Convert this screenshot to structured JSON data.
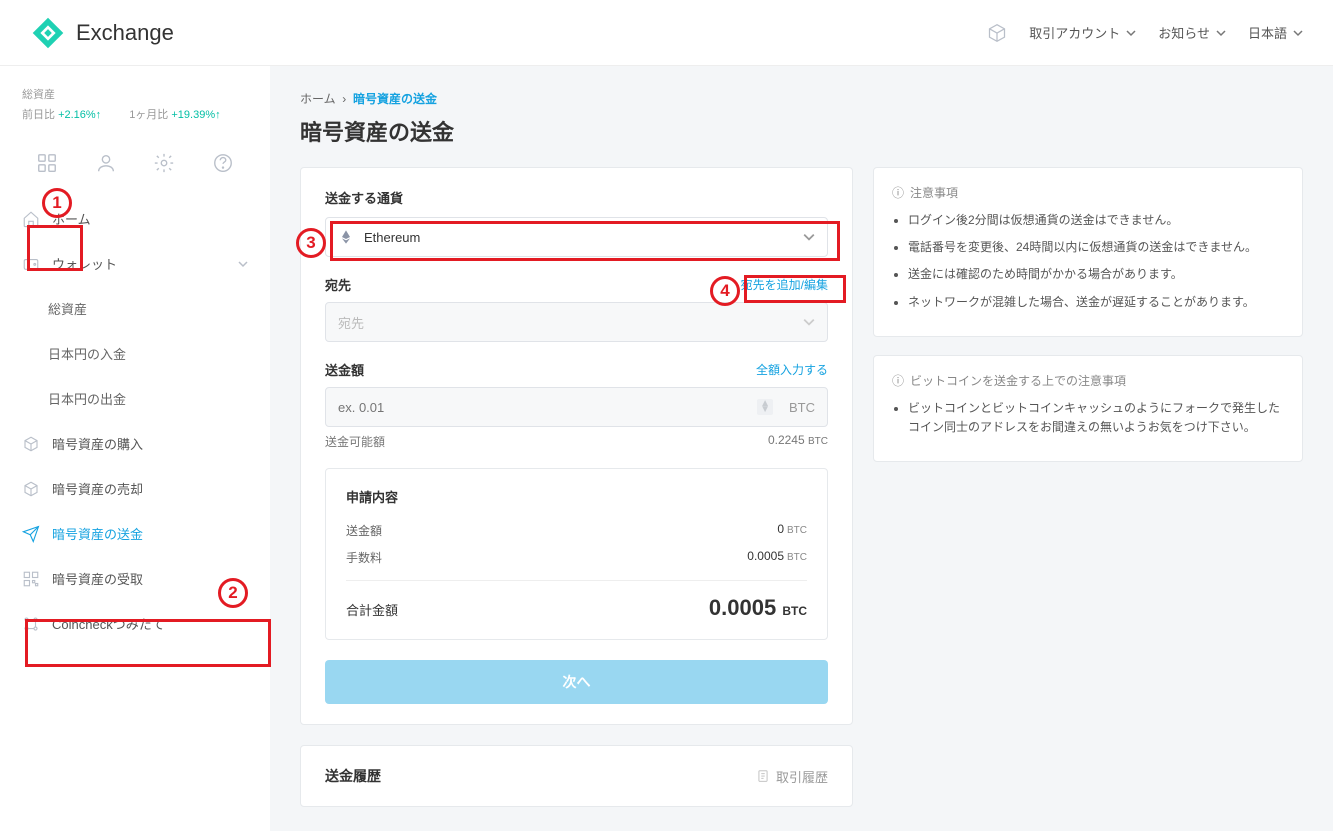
{
  "header": {
    "logo_text": "Exchange",
    "account_label": "取引アカウント",
    "news_label": "お知らせ",
    "lang_label": "日本語"
  },
  "sidebar": {
    "asset_label": "総資産",
    "day_label": "前日比",
    "day_change": "+2.16%↑",
    "month_label": "1ヶ月比",
    "month_change": "+19.39%↑",
    "home": "ホーム",
    "wallet": "ウォレット",
    "total_asset": "総資産",
    "jpy_deposit": "日本円の入金",
    "jpy_withdraw": "日本円の出金",
    "buy_crypto": "暗号資産の購入",
    "sell_crypto": "暗号資産の売却",
    "send_crypto": "暗号資産の送金",
    "receive_crypto": "暗号資産の受取",
    "coincheck_reserve": "Coincheckつみたて"
  },
  "breadcrumb": {
    "home": "ホーム",
    "current": "暗号資産の送金"
  },
  "page_title": "暗号資産の送金",
  "form": {
    "currency_label": "送金する通貨",
    "currency_value": "Ethereum",
    "dest_label": "宛先",
    "dest_add_link": "宛先を追加/編集",
    "dest_placeholder": "宛先",
    "amount_label": "送金額",
    "amount_all_link": "全額入力する",
    "amount_placeholder": "ex. 0.01",
    "amount_unit": "BTC",
    "available_label": "送金可能額",
    "available_value": "0.2245",
    "available_unit": "BTC"
  },
  "summary": {
    "title": "申請内容",
    "amount_label": "送金額",
    "amount_value": "0",
    "fee_label": "手数料",
    "fee_value": "0.0005",
    "total_label": "合計金額",
    "total_value": "0.0005",
    "unit": "BTC"
  },
  "submit_label": "次へ",
  "notice1": {
    "title": "注意事項",
    "items": [
      "ログイン後2分間は仮想通貨の送金はできません。",
      "電話番号を変更後、24時間以内に仮想通貨の送金はできません。",
      "送金には確認のため時間がかかる場合があります。",
      "ネットワークが混雑した場合、送金が遅延することがあります。"
    ]
  },
  "notice2": {
    "title": "ビットコインを送金する上での注意事項",
    "items": [
      "ビットコインとビットコインキャッシュのようにフォークで発生したコイン同士のアドレスをお間違えの無いようお気をつけ下さい。"
    ]
  },
  "history": {
    "title": "送金履歴",
    "link": "取引履歴"
  },
  "annotations": {
    "a1": "1",
    "a2": "2",
    "a3": "3",
    "a4": "4"
  }
}
